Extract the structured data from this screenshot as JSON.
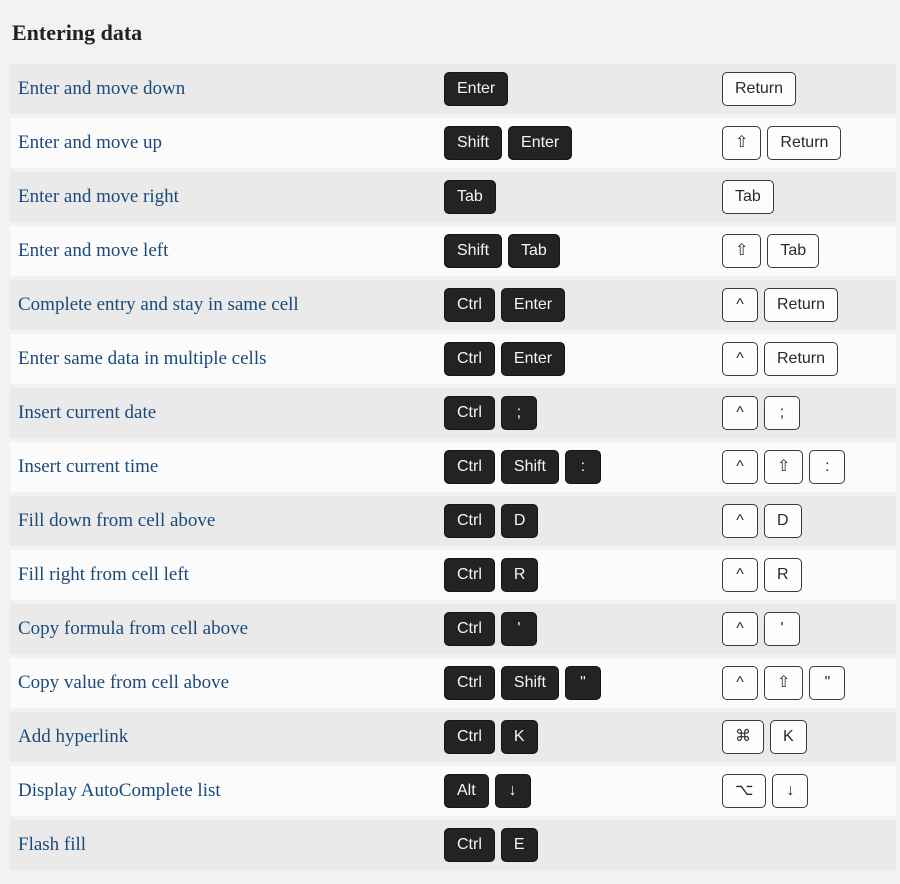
{
  "section_title": "Entering data",
  "rows": [
    {
      "desc": "Enter and move down",
      "win": [
        "Enter"
      ],
      "mac": [
        "Return"
      ]
    },
    {
      "desc": "Enter and move up",
      "win": [
        "Shift",
        "Enter"
      ],
      "mac": [
        "⇧",
        "Return"
      ]
    },
    {
      "desc": "Enter and move right",
      "win": [
        "Tab"
      ],
      "mac": [
        "Tab"
      ]
    },
    {
      "desc": "Enter and move left",
      "win": [
        "Shift",
        "Tab"
      ],
      "mac": [
        "⇧",
        "Tab"
      ]
    },
    {
      "desc": "Complete entry and stay in same cell",
      "win": [
        "Ctrl",
        "Enter"
      ],
      "mac": [
        "^",
        "Return"
      ]
    },
    {
      "desc": "Enter same data in multiple cells",
      "win": [
        "Ctrl",
        "Enter"
      ],
      "mac": [
        "^",
        "Return"
      ]
    },
    {
      "desc": "Insert current date",
      "win": [
        "Ctrl",
        ";"
      ],
      "mac": [
        "^",
        ";"
      ]
    },
    {
      "desc": "Insert current time",
      "win": [
        "Ctrl",
        "Shift",
        ":"
      ],
      "mac": [
        "^",
        "⇧",
        ":"
      ]
    },
    {
      "desc": "Fill down from cell above",
      "win": [
        "Ctrl",
        "D"
      ],
      "mac": [
        "^",
        "D"
      ]
    },
    {
      "desc": "Fill right from cell left",
      "win": [
        "Ctrl",
        "R"
      ],
      "mac": [
        "^",
        "R"
      ]
    },
    {
      "desc": "Copy formula from cell above",
      "win": [
        "Ctrl",
        "'"
      ],
      "mac": [
        "^",
        "'"
      ]
    },
    {
      "desc": "Copy value from cell above",
      "win": [
        "Ctrl",
        "Shift",
        "\""
      ],
      "mac": [
        "^",
        "⇧",
        "\""
      ]
    },
    {
      "desc": "Add hyperlink",
      "win": [
        "Ctrl",
        "K"
      ],
      "mac": [
        "⌘",
        "K"
      ]
    },
    {
      "desc": "Display AutoComplete list",
      "win": [
        "Alt",
        "↓"
      ],
      "mac": [
        "⌥",
        "↓"
      ]
    },
    {
      "desc": "Flash fill",
      "win": [
        "Ctrl",
        "E"
      ],
      "mac": []
    }
  ]
}
